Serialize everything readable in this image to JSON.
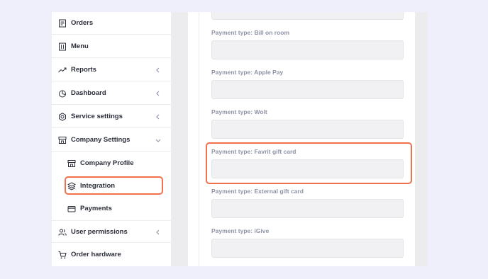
{
  "sidebar": {
    "items": [
      {
        "label": "Orders",
        "icon": "receipt-icon",
        "chevron": "none"
      },
      {
        "label": "Menu",
        "icon": "menu-book-icon",
        "chevron": "none"
      },
      {
        "label": "Reports",
        "icon": "trend-line-icon",
        "chevron": "left"
      },
      {
        "label": "Dashboard",
        "icon": "pie-chart-icon",
        "chevron": "left"
      },
      {
        "label": "Service settings",
        "icon": "gear-icon",
        "chevron": "left"
      },
      {
        "label": "Company Settings",
        "icon": "storefront-icon",
        "chevron": "down"
      }
    ],
    "subitems": [
      {
        "label": "Company Profile",
        "icon": "storefront-icon"
      },
      {
        "label": "Integration",
        "icon": "layers-icon",
        "selected": true
      },
      {
        "label": "Payments",
        "icon": "credit-card-icon"
      }
    ],
    "bottom_items": [
      {
        "label": "User permissions",
        "icon": "users-icon",
        "chevron": "left"
      },
      {
        "label": "Order hardware",
        "icon": "cart-icon",
        "chevron": "none"
      }
    ]
  },
  "payment_types": [
    {
      "label": "Payment type: Bill on room",
      "value": ""
    },
    {
      "label": "Payment type: Apple Pay",
      "value": ""
    },
    {
      "label": "Payment type: Wolt",
      "value": ""
    },
    {
      "label": "Payment type: Favrit gift card",
      "value": "",
      "highlighted": true
    },
    {
      "label": "Payment type: External gift card",
      "value": ""
    },
    {
      "label": "Payment type: iGive",
      "value": ""
    }
  ],
  "colors": {
    "highlight": "#f0714d",
    "page_bg": "#efeefb",
    "text": "#2b2e3a",
    "muted_label": "#8e93a6"
  }
}
